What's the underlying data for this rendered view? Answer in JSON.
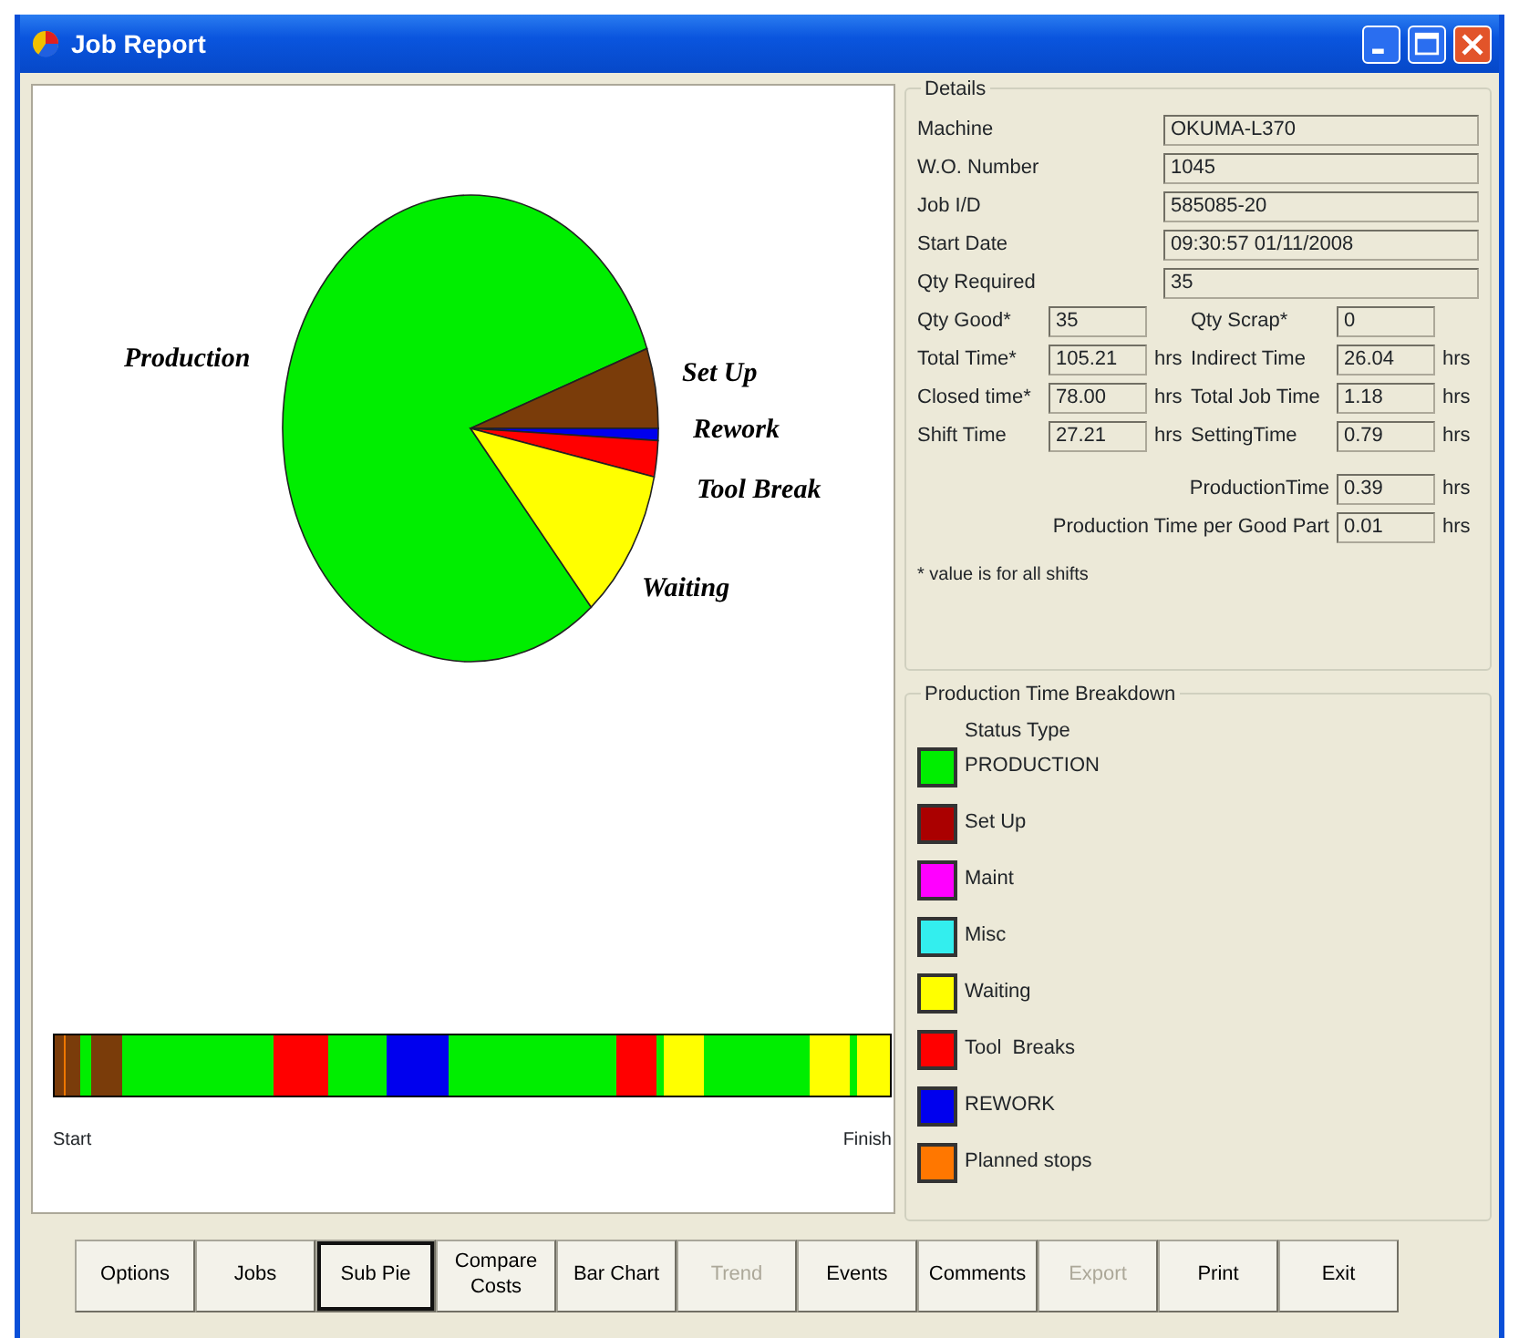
{
  "window": {
    "title": "Job Report"
  },
  "pie": {
    "slices": [
      {
        "label": "Production",
        "color": "#00ee00"
      },
      {
        "label": "Set Up",
        "color": "#7a3c0a"
      },
      {
        "label": "Rework",
        "color": "#0000ee"
      },
      {
        "label": "Tool Break",
        "color": "#ff0000"
      },
      {
        "label": "Waiting",
        "color": "#ffff00"
      }
    ]
  },
  "timeline": {
    "start_label": "Start",
    "finish_label": "Finish"
  },
  "details": {
    "title": "Details",
    "fields": [
      {
        "label": "Machine",
        "value": "OKUMA-L370"
      },
      {
        "label": "W.O. Number",
        "value": "1045"
      },
      {
        "label": "Job I/D",
        "value": "585085-20"
      },
      {
        "label": "Start Date",
        "value": "09:30:57 01/11/2008"
      },
      {
        "label": "Qty Required",
        "value": "35"
      }
    ],
    "pairs": [
      {
        "left": {
          "label": "Qty Good*",
          "value": "35"
        },
        "right": {
          "label": "Qty Scrap*",
          "value": "0"
        }
      },
      {
        "left": {
          "label": "Total Time*",
          "value": "105.21",
          "unit": "hrs"
        },
        "right": {
          "label": "Indirect Time",
          "value": "26.04",
          "unit": "hrs"
        }
      },
      {
        "left": {
          "label": "Closed time*",
          "value": "78.00",
          "unit": "hrs"
        },
        "right": {
          "label": "Total Job Time",
          "value": "1.18",
          "unit": "hrs"
        }
      },
      {
        "left": {
          "label": "Shift Time",
          "value": "27.21",
          "unit": "hrs"
        },
        "right": {
          "label": "SettingTime",
          "value": "0.79",
          "unit": "hrs"
        }
      }
    ],
    "totals": [
      {
        "label": "ProductionTime",
        "value": "0.39",
        "unit": "hrs"
      },
      {
        "label": "Production Time per Good Part",
        "value": "0.01",
        "unit": "hrs"
      }
    ],
    "note": "* value is for all shifts"
  },
  "breakdown": {
    "title": "Production Time Breakdown",
    "header": "Status Type",
    "items": [
      {
        "label": "PRODUCTION",
        "color": "#00ee00"
      },
      {
        "label": "Set Up",
        "color": "#aa0000"
      },
      {
        "label": "Maint",
        "color": "#ff00ff"
      },
      {
        "label": "Misc",
        "color": "#33eeee"
      },
      {
        "label": "Waiting",
        "color": "#ffff00"
      },
      {
        "label": "Tool  Breaks",
        "color": "#ff0000"
      },
      {
        "label": "REWORK",
        "color": "#0000ee"
      },
      {
        "label": "Planned stops",
        "color": "#ff7700"
      }
    ]
  },
  "buttons": [
    {
      "label": "Options",
      "disabled": false,
      "focused": false
    },
    {
      "label": "Jobs",
      "disabled": false,
      "focused": false
    },
    {
      "label": "Sub Pie",
      "disabled": false,
      "focused": true
    },
    {
      "label": "Compare Costs",
      "disabled": false,
      "focused": false
    },
    {
      "label": "Bar Chart",
      "disabled": false,
      "focused": false
    },
    {
      "label": "Trend",
      "disabled": true,
      "focused": false
    },
    {
      "label": "Events",
      "disabled": false,
      "focused": false
    },
    {
      "label": "Comments",
      "disabled": false,
      "focused": false
    },
    {
      "label": "Export",
      "disabled": true,
      "focused": false
    },
    {
      "label": "Print",
      "disabled": false,
      "focused": false
    },
    {
      "label": "Exit",
      "disabled": false,
      "focused": false
    }
  ]
}
